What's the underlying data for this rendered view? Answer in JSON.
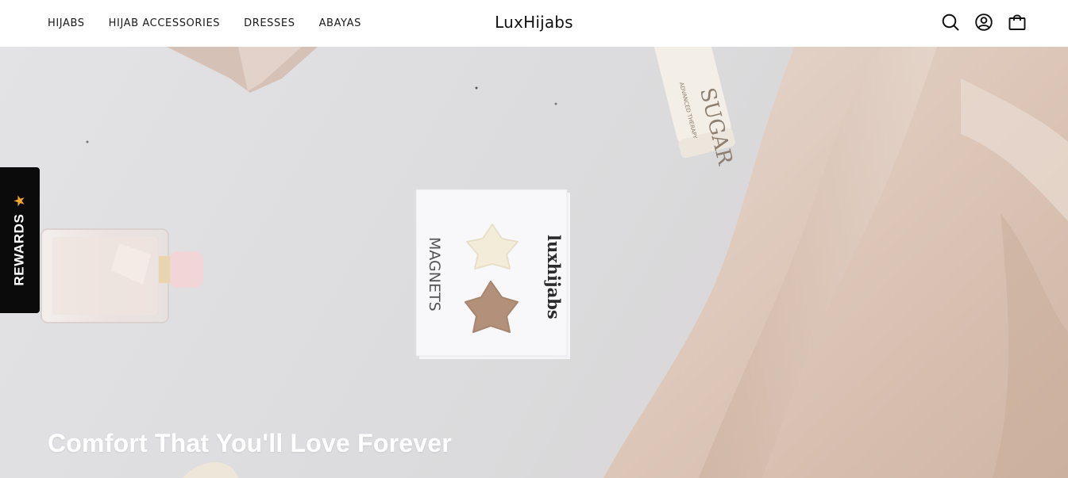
{
  "header": {
    "nav": [
      {
        "label": "HIJABS"
      },
      {
        "label": "HIJAB ACCESSORIES"
      },
      {
        "label": "DRESSES"
      },
      {
        "label": "ABAYAS"
      }
    ],
    "logo": "LuxHijabs",
    "icons": [
      "search-icon",
      "account-icon",
      "cart-icon"
    ]
  },
  "rewards": {
    "label": "REWARDS",
    "star": "★",
    "star_color": "#f2a82b"
  },
  "hero": {
    "title": "Comfort That You'll Love Forever",
    "scene": {
      "card_brand": "luxhijabs",
      "card_product": "MAGNETS",
      "tube_text": "SUGAR",
      "tube_subtext": "ADVANCED THERAPY"
    }
  }
}
